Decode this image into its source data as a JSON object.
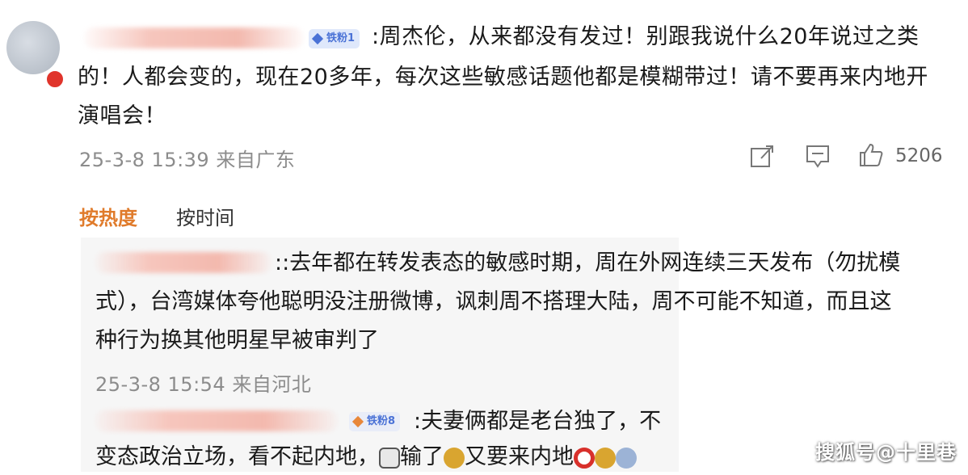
{
  "main_comment": {
    "badge_label": "铁粉1",
    "text_lines": [
      ":周杰伦，从来都没有发过！别跟我说什么20年说过之类",
      "的！人都会变的，现在20多年，每次这些敏感话题他都是模糊带过！请不要再来内地开",
      "演唱会！"
    ],
    "timestamp": "25-3-8 15:39 来自广东",
    "like_count": "5206"
  },
  "sort_tabs": {
    "hot": "按热度",
    "time": "按时间"
  },
  "replies": [
    {
      "text_lines": [
        "::去年都在转发表态的敏感时期，周在外网连续三天发布（勿扰模",
        "式），台湾媒体夸他聪明没注册微博，讽刺周不搭理大陆，周不可能不知道，而且这",
        "种行为换其他明星早被审判了"
      ],
      "timestamp": "25-3-8 15:54 来自河北"
    },
    {
      "badge_label": "铁粉8",
      "text_first": ":夫妻俩都是老台独了，不",
      "text_second_a": "变态政治立场，看不起内地，",
      "text_second_b": "输了",
      "text_second_c": "又要来内地"
    }
  ],
  "watermark": "搜狐号@十里巷",
  "colors": {
    "accent_hot": "#e07b2b",
    "meta_gray": "#8c8c8c",
    "badge_blue": "#4a72d6",
    "reply_bg": "#f6f6f6"
  },
  "icons": [
    "share-icon",
    "comment-icon",
    "like-icon"
  ]
}
